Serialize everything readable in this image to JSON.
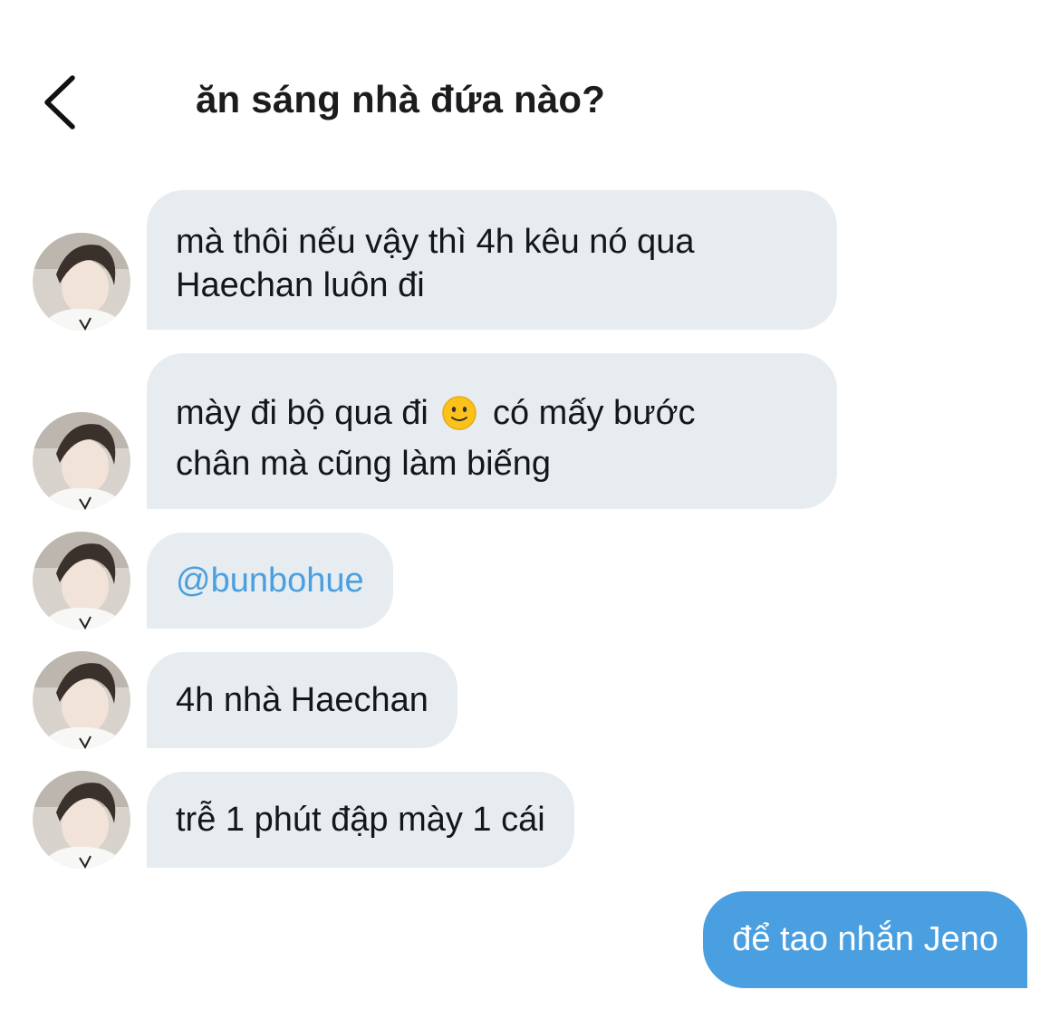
{
  "header": {
    "title": "ăn sáng nhà đứa nào?"
  },
  "messages": [
    {
      "line1": "mà thôi nếu vậy thì 4h kêu nó qua",
      "line2": "Haechan luôn đi"
    },
    {
      "line1_before": "mày đi bộ qua đi",
      "emoji": "slightly-smiling-face-icon",
      "line1_after": "có mấy bước",
      "line2": "chân mà cũng làm biếng"
    },
    {
      "mention": "@bunbohue"
    },
    {
      "text": "4h nhà Haechan"
    },
    {
      "text": "trễ 1 phút đập mày 1 cái"
    }
  ],
  "outgoing": {
    "text": "để tao nhắn Jeno"
  },
  "colors": {
    "incoming_bubble": "#e6ecf0",
    "outgoing_bubble": "#4a9fe0",
    "mention": "#4a9fe0",
    "background": "#ffffff"
  }
}
